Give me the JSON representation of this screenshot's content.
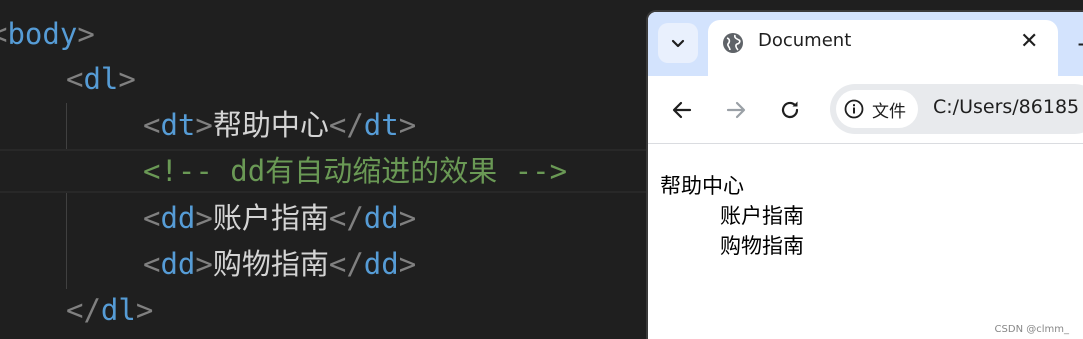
{
  "editor": {
    "lines": [
      {
        "open": "<",
        "tag": "body",
        "close": ">"
      },
      {
        "open": "<",
        "tag": "dl",
        "close": ">"
      },
      {
        "open1": "<",
        "tag1": "dt",
        "close1": ">",
        "text": "帮助中心",
        "open2": "</",
        "tag2": "dt",
        "close2": ">"
      },
      {
        "comment": "<!-- dd有自动缩进的效果 -->"
      },
      {
        "open1": "<",
        "tag1": "dd",
        "close1": ">",
        "text": "账户指南",
        "open2": "</",
        "tag2": "dd",
        "close2": ">"
      },
      {
        "open1": "<",
        "tag1": "dd",
        "close1": ">",
        "text": "购物指南",
        "open2": "</",
        "tag2": "dd",
        "close2": ">"
      },
      {
        "open": "</",
        "tag": "dl",
        "close": ">"
      }
    ]
  },
  "browser": {
    "tab_title": "Document",
    "omnibox_chip": "文件",
    "url": "C:/Users/86185",
    "icons": [
      "chevron-down-icon",
      "globe-icon",
      "close-icon",
      "new-tab-icon",
      "back-icon",
      "forward-icon",
      "reload-icon",
      "info-icon"
    ]
  },
  "page": {
    "dt": "帮助中心",
    "dd": [
      "账户指南",
      "购物指南"
    ]
  },
  "watermark": "CSDN @clmm_",
  "colors": {
    "editor_bg": "#1f1f1f",
    "tag": "#569cd6",
    "comment": "#6a9955",
    "bracket": "#808080",
    "tabbar": "#d3e3fd"
  }
}
